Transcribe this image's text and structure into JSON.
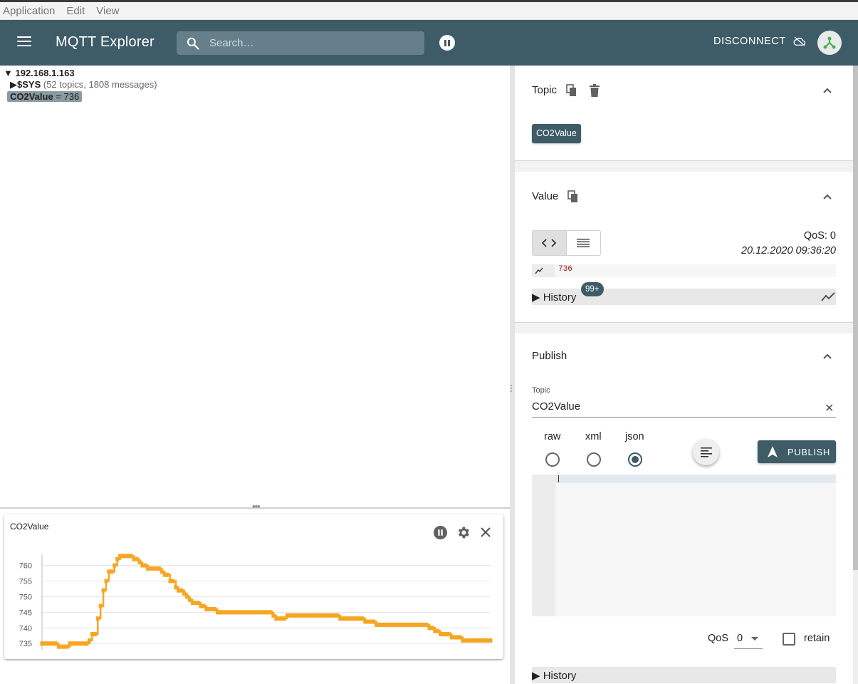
{
  "menubar": {
    "items": [
      "Application",
      "Edit",
      "View"
    ]
  },
  "appbar": {
    "title": "MQTT Explorer",
    "search_placeholder": "Search…",
    "disconnect_label": "DISCONNECT"
  },
  "tree": {
    "root": "192.168.1.163",
    "sys_name": "$SYS",
    "sys_meta": "(52 topics, 1808 messages)",
    "co2_name": "CO2Value",
    "co2_value": " = 736"
  },
  "chart_panel": {
    "title": "CO2Value"
  },
  "chart_data": {
    "type": "line",
    "title": "CO2Value",
    "yticks": [
      735,
      740,
      745,
      750,
      755,
      760
    ],
    "ylim": [
      733,
      764
    ],
    "color": "#f5a623",
    "grid": true,
    "x": [
      0,
      1,
      2,
      3,
      4,
      5,
      6,
      7,
      8,
      9,
      10,
      11,
      12,
      13,
      14,
      15,
      16,
      17,
      18,
      19,
      20,
      21,
      22,
      23,
      24,
      25,
      26,
      27,
      28,
      29,
      30,
      31,
      32,
      33,
      34,
      35,
      36,
      37,
      38,
      39,
      40,
      41,
      42,
      43,
      44,
      45,
      46,
      47,
      48,
      49,
      50,
      51,
      52,
      53,
      54,
      55,
      56,
      57,
      58,
      59,
      60,
      61,
      62,
      63,
      64,
      65,
      66,
      67,
      68,
      69,
      70,
      71,
      72,
      73,
      74,
      75,
      76,
      77,
      78,
      79,
      80,
      81,
      82,
      83,
      84,
      85,
      86,
      87,
      88,
      89,
      90,
      91,
      92,
      93,
      94,
      95,
      96,
      97,
      98,
      99,
      100,
      101,
      102,
      103,
      104,
      105,
      106,
      107,
      108,
      109,
      110,
      111,
      112,
      113,
      114,
      115,
      116,
      117,
      118,
      119,
      120,
      121,
      122,
      123,
      124,
      125,
      126,
      127,
      128,
      129,
      130,
      131,
      132,
      133,
      134,
      135,
      136,
      137,
      138,
      139,
      140,
      141,
      142,
      143,
      144,
      145,
      146,
      147,
      148,
      149,
      150,
      151,
      152,
      153,
      154,
      155,
      156,
      157,
      158,
      159,
      160
    ],
    "values": [
      735,
      735,
      735,
      735,
      735,
      735,
      734,
      734,
      734,
      734,
      735,
      735,
      735,
      735,
      735,
      735,
      735,
      736,
      738,
      738,
      743,
      747,
      752,
      755,
      758,
      758,
      760,
      762,
      763,
      763,
      763,
      763,
      763,
      762,
      762,
      761,
      760,
      760,
      759,
      759,
      759,
      759,
      759,
      758,
      757,
      757,
      755,
      755,
      753,
      752,
      752,
      751,
      750,
      749,
      748,
      748,
      748,
      747,
      747,
      746,
      746,
      746,
      746,
      745,
      745,
      745,
      745,
      745,
      745,
      745,
      745,
      745,
      745,
      745,
      745,
      745,
      745,
      745,
      745,
      745,
      745,
      745,
      745,
      744,
      743,
      743,
      743,
      743,
      744,
      744,
      744,
      744,
      744,
      744,
      744,
      744,
      744,
      744,
      744,
      744,
      744,
      744,
      744,
      744,
      744,
      744,
      744,
      743,
      743,
      743,
      743,
      743,
      743,
      743,
      743,
      743,
      742,
      742,
      742,
      742,
      741,
      741,
      741,
      741,
      741,
      741,
      741,
      741,
      741,
      741,
      741,
      741,
      741,
      741,
      741,
      741,
      741,
      741,
      741,
      740,
      740,
      739,
      739,
      738,
      738,
      738,
      738,
      737,
      737,
      737,
      737,
      736,
      736,
      736,
      736,
      736,
      736,
      736,
      736,
      736,
      736,
      736
    ]
  },
  "topic_section": {
    "title": "Topic",
    "chip": "CO2Value"
  },
  "value_section": {
    "title": "Value",
    "qos": "QoS: 0",
    "timestamp": "20.12.2020 09:36:20",
    "raw_value": "736",
    "history_label": "History",
    "history_badge": "99+"
  },
  "publish_section": {
    "title": "Publish",
    "topic_label": "Topic",
    "topic_value": "CO2Value",
    "formats": [
      "raw",
      "xml",
      "json"
    ],
    "selected_format": "json",
    "publish_label": "PUBLISH",
    "qos_label": "QoS",
    "qos_value": "0",
    "retain_label": "retain",
    "history_label": "History"
  }
}
